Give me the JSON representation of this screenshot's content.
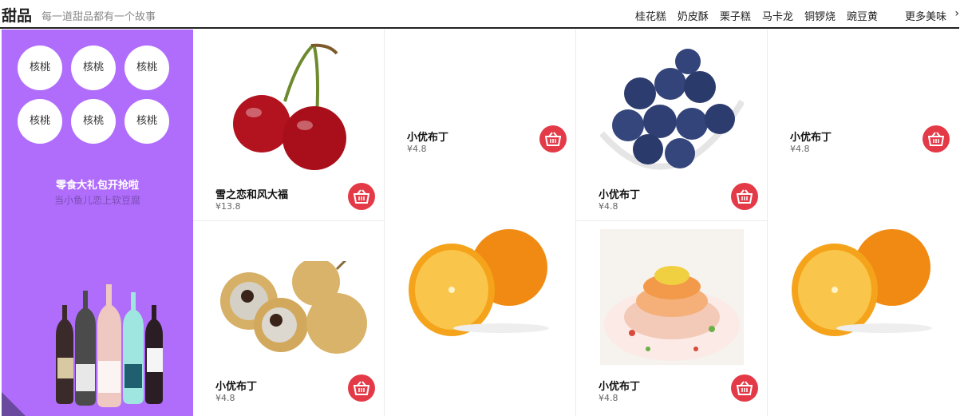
{
  "header": {
    "title": "甜品",
    "subtitle": "每一道甜品都有一个故事",
    "nav": [
      "桂花糕",
      "奶皮酥",
      "栗子糕",
      "马卡龙",
      "铜锣烧",
      "豌豆黄"
    ],
    "more": "更多美味"
  },
  "sidebar": {
    "bubbles": [
      "核桃",
      "核桃",
      "核桃",
      "核桃",
      "核桃",
      "核桃"
    ],
    "promo_title": "零食大礼包开抢啦",
    "promo_sub": "当小鱼儿恋上软豆腐"
  },
  "products": [
    {
      "name": "雪之恋和风大福",
      "price": "¥13.8",
      "image": "cherry"
    },
    {
      "name": "小优布丁",
      "price": "¥4.8",
      "image": "none"
    },
    {
      "name": "小优布丁",
      "price": "¥4.8",
      "image": "blueberry"
    },
    {
      "name": "小优布丁",
      "price": "¥4.8",
      "image": "none"
    },
    {
      "name": "小优布丁",
      "price": "¥4.8",
      "image": "longan"
    },
    {
      "name": "",
      "price": "",
      "image": "orange"
    },
    {
      "name": "小优布丁",
      "price": "¥4.8",
      "image": "dessert-plate"
    },
    {
      "name": "",
      "price": "",
      "image": "orange"
    }
  ],
  "colors": {
    "sidebar": "#b06dfc",
    "cart": "#e43a48"
  }
}
